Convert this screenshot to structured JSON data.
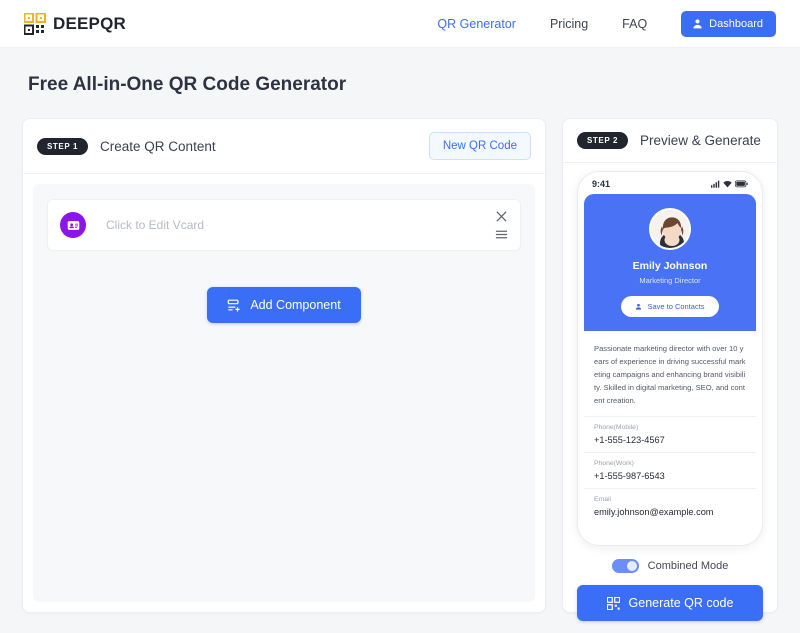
{
  "header": {
    "brand": "DEEPQR",
    "brand_icon": "qr-logo-icon",
    "nav": [
      {
        "label": "QR Generator",
        "active": true
      },
      {
        "label": "Pricing",
        "active": false
      },
      {
        "label": "FAQ",
        "active": false
      }
    ],
    "dashboard_button": {
      "label": "Dashboard",
      "icon": "user-icon"
    }
  },
  "page": {
    "title": "Free All-in-One QR Code Generator"
  },
  "step1": {
    "badge": "STEP 1",
    "title": "Create QR Content",
    "new_qr_button": "New QR Code",
    "component": {
      "icon": "vcard-icon",
      "label": "Click to Edit Vcard",
      "close_icon": "close-icon",
      "drag_icon": "drag-handle-icon"
    },
    "add_component_button": {
      "label": "Add Component",
      "icon": "add-component-icon"
    }
  },
  "step2": {
    "badge": "STEP 2",
    "title": "Preview & Generate",
    "phone": {
      "status_time": "9:41",
      "status_icons": [
        "signal-icon",
        "wifi-icon",
        "battery-icon"
      ],
      "name": "Emily Johnson",
      "role": "Marketing Director",
      "save_button": {
        "label": "Save to Contacts",
        "icon": "user-icon"
      },
      "bio": "Passionate marketing director with over 10 years of experience in driving successful marketing campaigns and enhancing brand visibility. Skilled in digital marketing, SEO, and content creation.",
      "fields": [
        {
          "label": "Phone(Mobile)",
          "value": "+1-555-123-4567"
        },
        {
          "label": "Phone(Work)",
          "value": "+1-555-987-6543"
        },
        {
          "label": "Email",
          "value": "emily.johnson@example.com"
        }
      ]
    },
    "toggle": {
      "label": "Combined Mode",
      "state": "on"
    },
    "generate_button": {
      "label": "Generate QR code",
      "icon": "qr-icon"
    }
  },
  "colors": {
    "accent": "#3b6ef6",
    "hero": "#4a72f5",
    "badge": "#21262e",
    "vcard_purple": "#8b16e8",
    "logo_gold": "#f0b323",
    "page_bg": "#f5f6f8"
  }
}
